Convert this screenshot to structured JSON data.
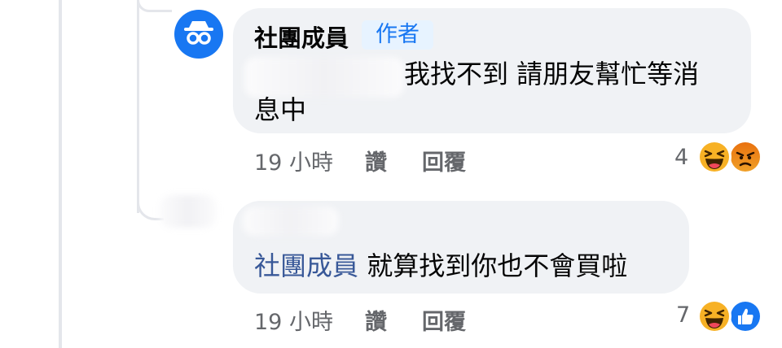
{
  "comments": [
    {
      "author": "社團成員",
      "badge": "作者",
      "text_line1": "我找不到 請朋友幫忙等消",
      "text_line2": "息中",
      "time": "19 小時",
      "like_label": "讚",
      "reply_label": "回覆",
      "reaction_count": "4",
      "reactions": [
        "haha-icon",
        "angry-icon"
      ]
    },
    {
      "mention": "社團成員",
      "text": " 就算找到你也不會買啦",
      "time": "19 小時",
      "like_label": "讚",
      "reply_label": "回覆",
      "reaction_count": "7",
      "reactions": [
        "haha-icon",
        "like-icon"
      ]
    }
  ],
  "colors": {
    "accent": "#1877f2",
    "bubble": "#f0f2f5",
    "meta_text": "#65676b"
  }
}
